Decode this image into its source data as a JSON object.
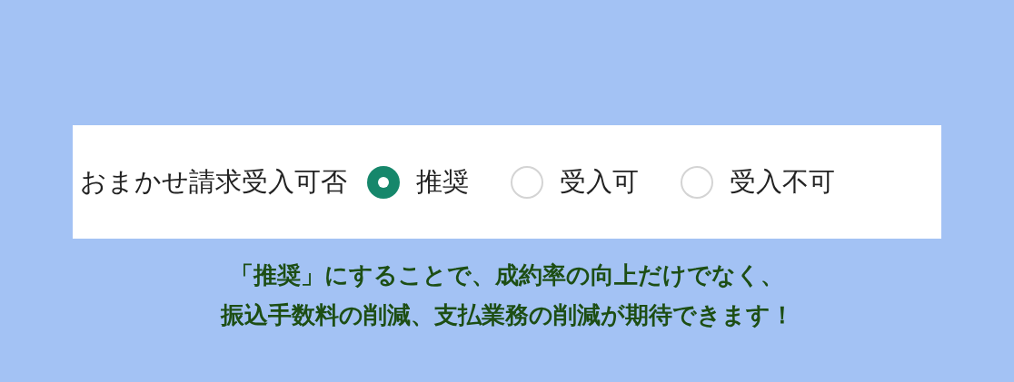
{
  "field": {
    "label": "おまかせ請求受入可否",
    "options": [
      {
        "label": "推奨",
        "selected": true
      },
      {
        "label": "受入可",
        "selected": false
      },
      {
        "label": "受入不可",
        "selected": false
      }
    ]
  },
  "note": [
    "「推奨」にすることで、成約率の向上だけでなく、",
    "振込手数料の削減、支払業務の削減が期待できます！"
  ]
}
